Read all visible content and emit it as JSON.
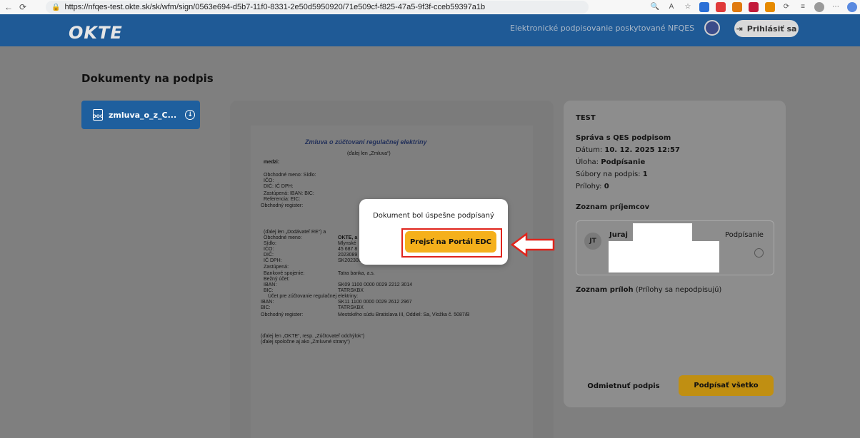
{
  "browser": {
    "url": "https://nfqes-test.okte.sk/sk/wfm/sign/0563e694-d5b7-11f0-8331-2e50d5950920/71e509cf-f825-47a5-9f3f-cceb59397a1b"
  },
  "header": {
    "logo": "OKTE",
    "tagline": "Elektronické podpisovanie poskytované NFQES",
    "login_label": "Prihlásiť sa"
  },
  "page": {
    "title": "Dokumenty na podpis",
    "file_name": "zmluva_o_z_C..."
  },
  "document": {
    "title": "Zmluva o zúčtovaní regulačnej elektriny",
    "subtitle": "(ďalej len „Zmluva“)",
    "lines": [
      "medzi:",
      "Obchodné meno:    Sídlo:",
      "IČO:",
      "DIČ:   IČ DPH:",
      "Zastúpená:   IBAN:  BIC:",
      "Referencia:   EIC:",
      "Obchodný register:",
      "(ďalej len „Dodávateľ RE“) a",
      "Obchodné meno:",
      "Sídlo:",
      "IČO:",
      "DIČ:",
      "IČ DPH:",
      "Zastúpená:",
      "Bankové spojenie:",
      "Bežný účet:",
      "IBAN:",
      "BIC:",
      "Účet pre zúčtovanie regulačnej elektriny:",
      "IBAN:",
      "BIC:",
      "Obchodný register:",
      "(ďalej len „OKTE“, resp. „Zúčtovateľ odchýlok“)",
      "(ďalej spoločne aj ako „Zmluvné strany“)"
    ],
    "values": {
      "name": "OKTE, a",
      "seat": "Mlynské",
      "ico": "45 687 8",
      "dic": "2023089",
      "icdph": "SK2023089728",
      "bank": "Tatra banka, a.s.",
      "iban1": "SK09 1100 0000 0029 2212 3014",
      "bic1": "TATRSKBX",
      "iban2": "SK11 1100 0000 0029 2612 2967",
      "bic2": "TATRSKBX",
      "register": "Mestského súdu Bratislava III, Oddiel: Sa, Vložka č. 5087/B"
    }
  },
  "modal": {
    "message": "Dokument bol úspešne podpísaný",
    "button_label": "Prejsť na Portál EDC"
  },
  "details": {
    "heading": "TEST",
    "message_title": "Správa s QES podpisom",
    "date_label": "Dátum:",
    "date_value": "10. 12. 2025 12:57",
    "task_label": "Úloha:",
    "task_value": "Podpísanie",
    "files_label": "Súbory na podpis:",
    "files_value": "1",
    "attachments_label": "Prílohy:",
    "attachments_value": "0",
    "recipients_heading": "Zoznam príjemcov",
    "recipient_initials": "JT",
    "recipient_name": "Juraj",
    "recipient_status": "Podpísanie",
    "attachments_heading": "Zoznam príloh",
    "attachments_note": "(Prílohy sa nepodpisujú)",
    "reject_label": "Odmietnuť podpis",
    "sign_all_label": "Podpísať všetko"
  }
}
